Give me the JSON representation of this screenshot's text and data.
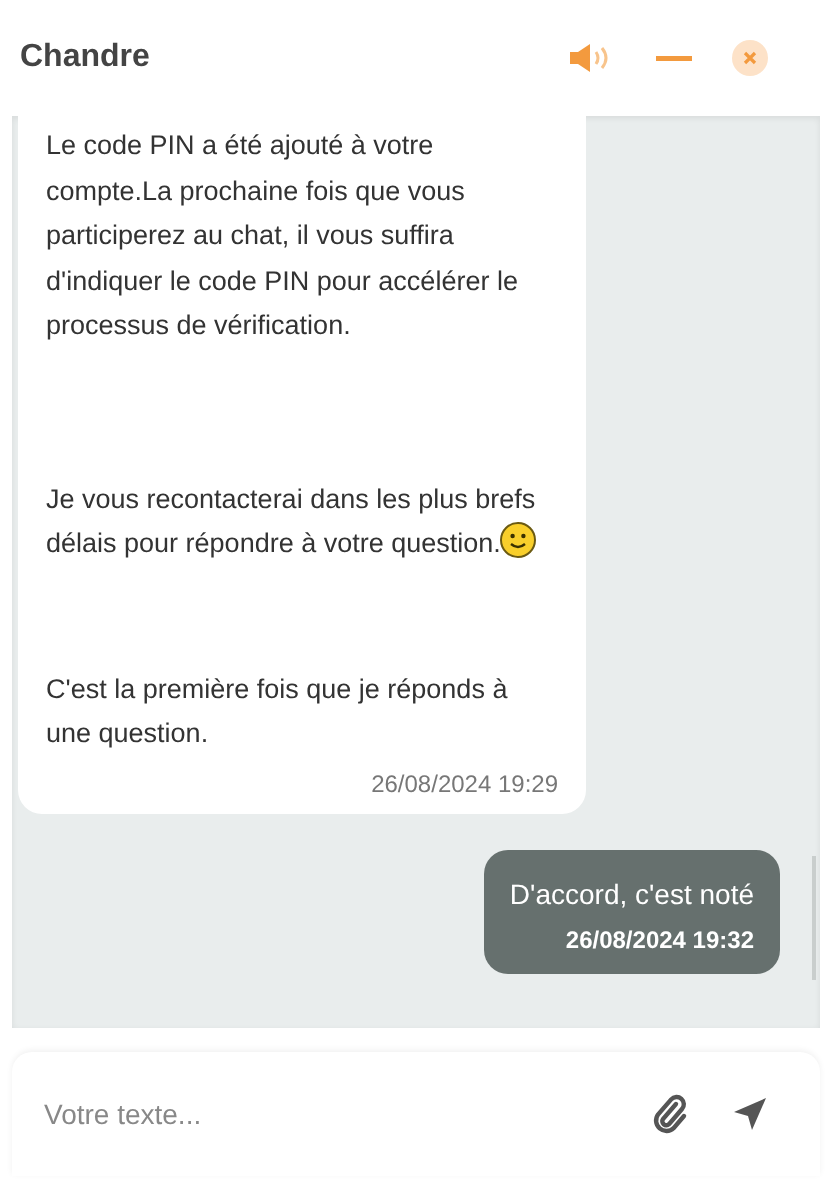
{
  "header": {
    "title": "Chandre"
  },
  "messages": [
    {
      "kind": "received",
      "paragraphs": [
        {
          "kind": "text",
          "text": "Le code PIN a été ajouté à votre compte.La prochaine fois que vous participerez au chat, il vous suffira d'indiquer le code PIN pour accélérer le processus de vérification."
        },
        {
          "kind": "text-with-smiley",
          "text": "Je vous recontacterai dans les plus brefs délais pour répondre à votre question."
        },
        {
          "kind": "text",
          "text": "C'est la première fois que je réponds à une question."
        }
      ],
      "time": "26/08/2024 19:29"
    },
    {
      "kind": "sent",
      "paragraphs": [
        {
          "kind": "text",
          "text": "D'accord, c'est noté"
        }
      ],
      "time": "26/08/2024 19:32"
    }
  ],
  "composer": {
    "placeholder": "Votre texte..."
  }
}
